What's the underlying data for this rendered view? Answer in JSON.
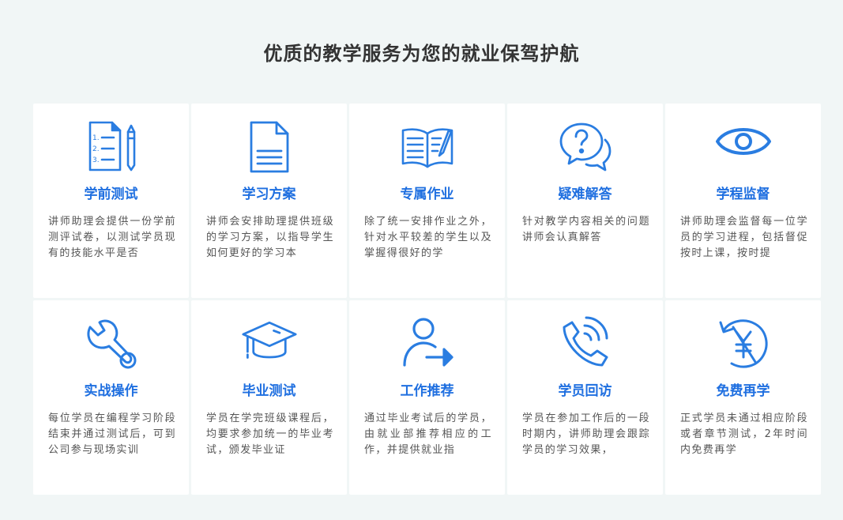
{
  "section": {
    "title": "优质的教学服务为您的就业保驾护航"
  },
  "colors": {
    "accent": "#1f6fe0",
    "icon": "#2a7de1",
    "background": "#f1f6f6",
    "card": "#ffffff",
    "text": "#555555"
  },
  "cards": [
    {
      "icon": "test-paper-icon",
      "title": "学前测试",
      "desc": "讲师助理会提供一份学前测评试卷，以测试学员现有的技能水平是否"
    },
    {
      "icon": "document-icon",
      "title": "学习方案",
      "desc": "讲师会安排助理提供班级的学习方案，以指导学生如何更好的学习本"
    },
    {
      "icon": "open-book-icon",
      "title": "专属作业",
      "desc": "除了统一安排作业之外，针对水平较差的学生以及掌握得很好的学"
    },
    {
      "icon": "question-chat-icon",
      "title": "疑难解答",
      "desc": "针对教学内容相关的问题讲师会认真解答"
    },
    {
      "icon": "eye-icon",
      "title": "学程监督",
      "desc": "讲师助理会监督每一位学员的学习进程，包括督促按时上课，按时提"
    },
    {
      "icon": "wrench-icon",
      "title": "实战操作",
      "desc": "每位学员在编程学习阶段结束并通过测试后，可到公司参与现场实训"
    },
    {
      "icon": "graduation-cap-icon",
      "title": "毕业测试",
      "desc": "学员在学完班级课程后，均要求参加统一的毕业考试，颁发毕业证"
    },
    {
      "icon": "user-arrow-icon",
      "title": "工作推荐",
      "desc": "通过毕业考试后的学员，由就业部推荐相应的工作，并提供就业指"
    },
    {
      "icon": "phone-call-icon",
      "title": "学员回访",
      "desc": "学员在参加工作后的一段时期内，讲师助理会跟踪学员的学习效果，"
    },
    {
      "icon": "yen-refresh-icon",
      "title": "免费再学",
      "desc": "正式学员未通过相应阶段或者章节测试，2年时间内免费再学"
    }
  ]
}
